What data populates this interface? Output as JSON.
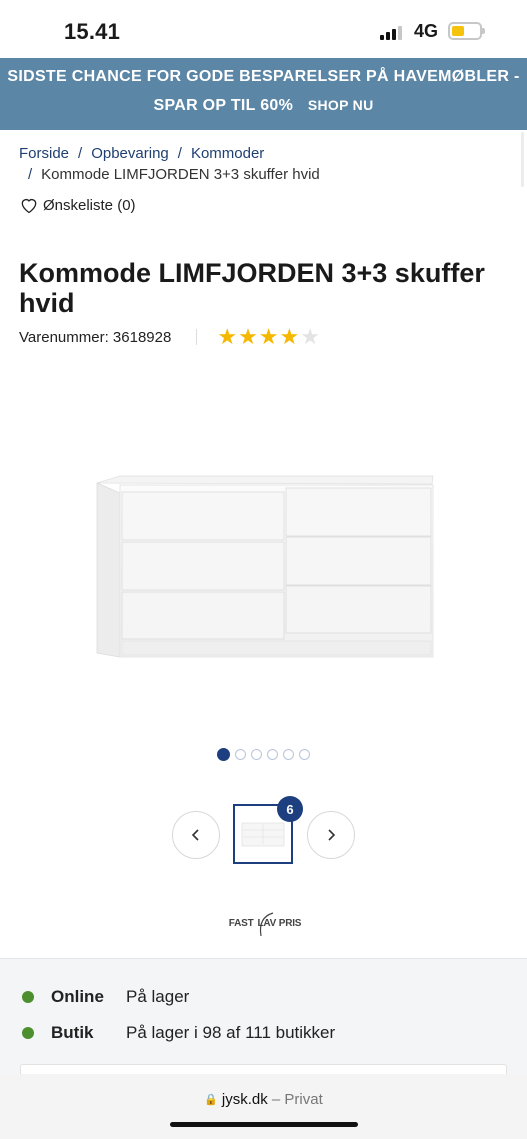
{
  "status_bar": {
    "time": "15.41",
    "network": "4G"
  },
  "promo": {
    "line1": "SIDSTE CHANCE FOR GODE BESPARELSER PÅ HAVEMØBLER -",
    "line2": "SPAR OP TIL 60%",
    "link": "SHOP NU",
    "color": "#5b86a6"
  },
  "breadcrumb": {
    "items": [
      "Forside",
      "Opbevaring",
      "Kommoder"
    ],
    "current": "Kommode LIMFJORDEN 3+3 skuffer hvid",
    "separator": "/"
  },
  "wishlist": {
    "label": "Ønskeliste (0)"
  },
  "product": {
    "title": "Kommode LIMFJORDEN 3+3 skuffer hvid",
    "sku": "Varenummer: 3618928",
    "rating": 4,
    "rating_max": 5
  },
  "gallery": {
    "dot_count": 6,
    "active_index": 0,
    "thumb_count": "6",
    "prev_icon": "chevron-left-icon",
    "next_icon": "chevron-right-icon"
  },
  "logo": {
    "fast": "FAST",
    "lav": "LAV PRIS"
  },
  "availability": [
    {
      "channel": "Online",
      "status": "På lager",
      "color": "#4d8f2e"
    },
    {
      "channel": "Butik",
      "status": "På lager i 98 af 111 butikker",
      "color": "#4d8f2e"
    }
  ],
  "browser": {
    "domain": "jysk.dk",
    "mode": "– Privat"
  },
  "colors": {
    "accent": "#1d3f80",
    "link": "#1f3f73",
    "star": "#f5b800"
  }
}
